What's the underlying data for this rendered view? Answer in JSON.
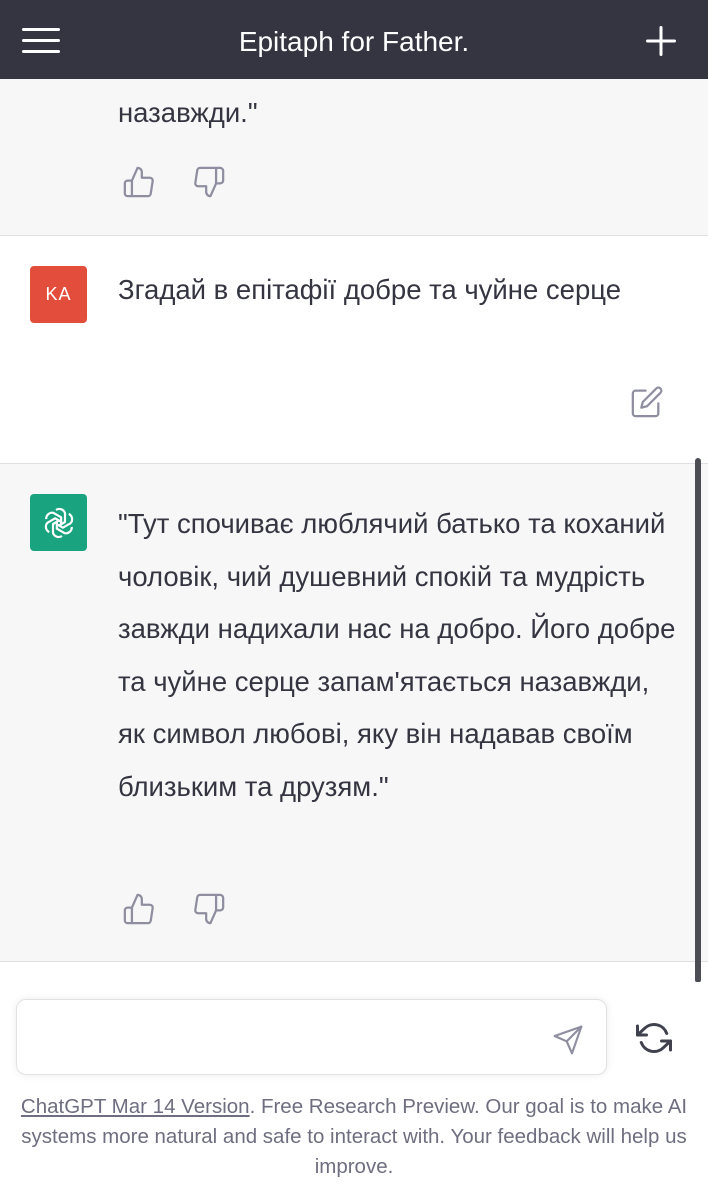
{
  "header": {
    "title": "Epitaph for Father.",
    "menu_icon": "hamburger-menu-icon",
    "new_chat_icon": "plus-icon"
  },
  "messages": [
    {
      "role": "assistant",
      "text": "назавжди.\""
    },
    {
      "role": "user",
      "avatar": "KA",
      "text": "Згадай в епітафії добре та чуйне серце"
    },
    {
      "role": "assistant",
      "text": "\"Тут спочиває люблячий батько та коханий чоловік, чий душевний спокій та мудрість завжди надихали нас на добро. Його добре та чуйне серце запам'ятається назавжди, як символ любові, яку він надавав своїм близьким та друзям.\""
    }
  ],
  "input": {
    "value": "",
    "placeholder": ""
  },
  "footer": {
    "link": "ChatGPT Mar 14 Version",
    "text": ". Free Research Preview. Our goal is to make AI systems more natural and safe to interact with. Your feedback will help us improve."
  },
  "colors": {
    "header_bg": "#343541",
    "user_avatar": "#e34d3c",
    "assistant_avatar": "#19a37f",
    "assistant_bg": "#f7f7f8"
  }
}
